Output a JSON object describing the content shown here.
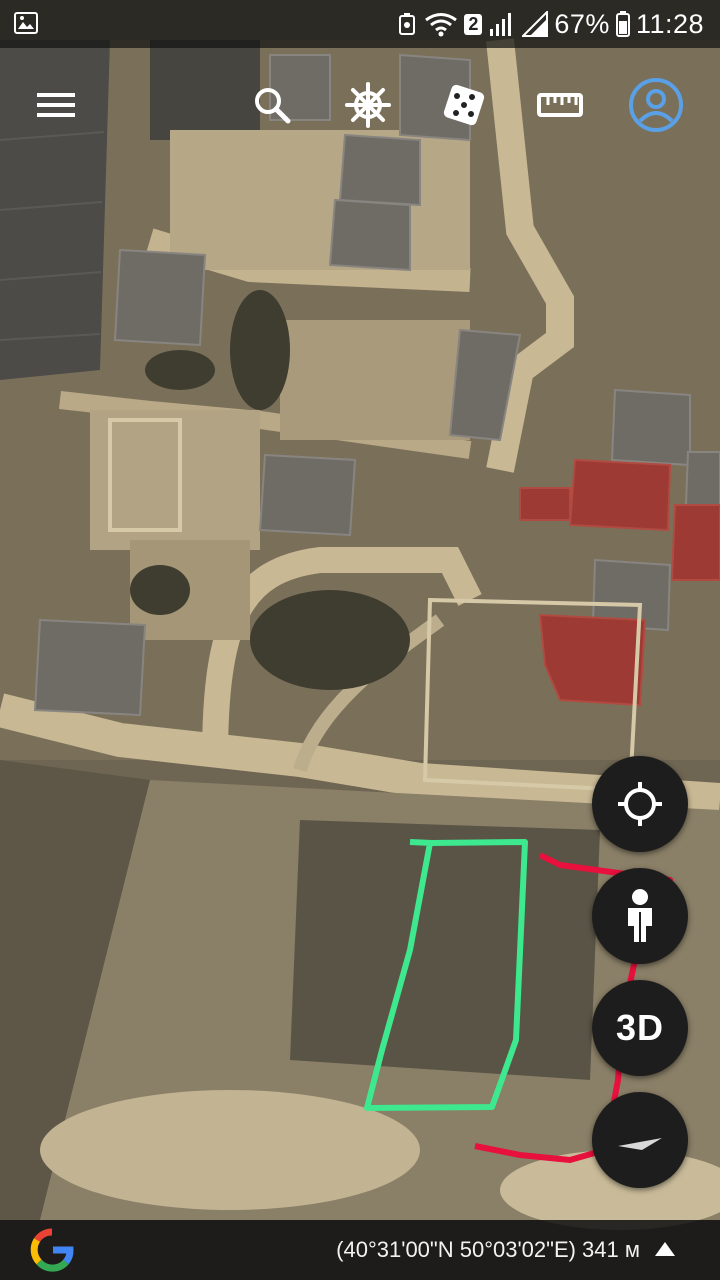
{
  "status_bar": {
    "notification_count": "2",
    "battery": "67%",
    "time": "11:28"
  },
  "toolbar": {
    "items": [
      "menu",
      "search",
      "voyager",
      "feeling-lucky",
      "measure",
      "account"
    ]
  },
  "fabs": {
    "three_d_label": "3D"
  },
  "bottom_bar": {
    "coordinates": "(40°31'00\"N 50°03'02\"E) 341 м"
  },
  "colors": {
    "account_accent": "#5aa0e6",
    "green_outline": "#3de88e",
    "red_outline": "#e8103c"
  }
}
